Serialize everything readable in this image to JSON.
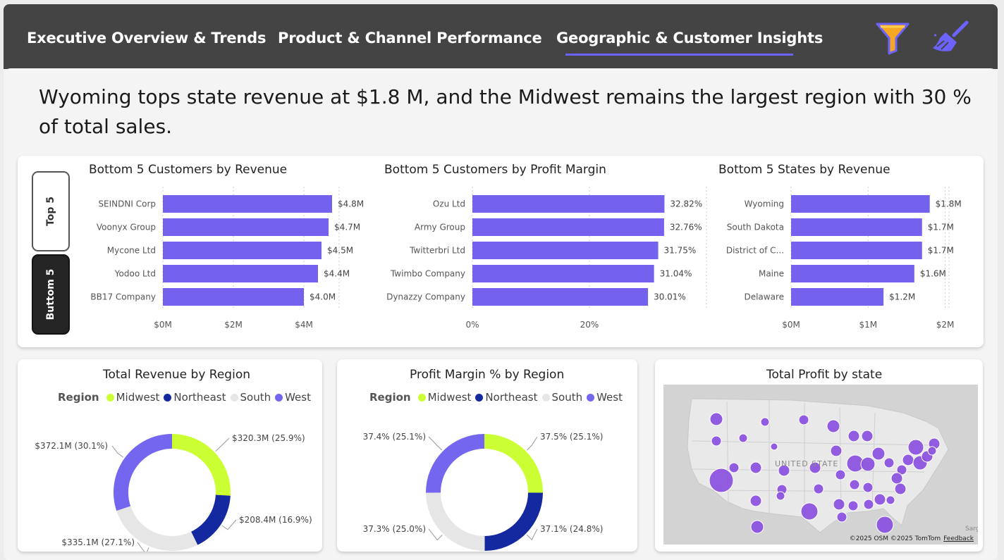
{
  "nav": {
    "tabs": [
      {
        "label": "Executive Overview & Trends"
      },
      {
        "label": "Product & Channel Performance"
      },
      {
        "label": "Geographic & Customer Insights"
      }
    ],
    "filter_icon": "filter-icon",
    "clear_icon": "broom-icon"
  },
  "headline": "Wyoming tops state revenue at $1.8 M, and the Midwest remains the largest region with 30 % of total sales.",
  "toggle": {
    "top_label": "Top 5",
    "bottom_label": "Buttom 5"
  },
  "colors": {
    "bar": "#7462ee",
    "midwest": "#ccff33",
    "northeast": "#1428a0",
    "south": "#e6e6e6",
    "west": "#7466ee",
    "bubble": "#8a4fe0"
  },
  "legend": {
    "title": "Region",
    "items": [
      "Midwest",
      "Northeast",
      "South",
      "West"
    ]
  },
  "map": {
    "title": "Total Profit by state",
    "label": "UNITED STATE",
    "edge_label": "Sarg",
    "attribution": "©2025 OSM  ©2025 TomTom",
    "feedback": "Feedback"
  },
  "chart_data": [
    {
      "type": "bar",
      "orientation": "horizontal",
      "title": "Bottom 5 Customers by Revenue",
      "categories": [
        "SEINDNI Corp",
        "Voonyx Group",
        "Mycone Ltd",
        "Yodoo Ltd",
        "BB17 Company"
      ],
      "values": [
        4.8,
        4.7,
        4.5,
        4.4,
        4.0
      ],
      "data_labels": [
        "$4.8M",
        "$4.7M",
        "$4.5M",
        "$4.4M",
        "$4.0M"
      ],
      "xlim": [
        0,
        5
      ],
      "ticks": [
        0,
        2,
        4
      ],
      "tick_labels": [
        "$0M",
        "$2M",
        "$4M"
      ]
    },
    {
      "type": "bar",
      "orientation": "horizontal",
      "title": "Bottom 5 Customers by Profit Margin",
      "categories": [
        "Ozu Ltd",
        "Army Group",
        "Twitterbri Ltd",
        "Twimbo Company",
        "Dynazzy Company"
      ],
      "values": [
        32.82,
        32.76,
        31.75,
        31.04,
        30.01
      ],
      "data_labels": [
        "32.82%",
        "32.76%",
        "31.75%",
        "31.04%",
        "30.01%"
      ],
      "xlim": [
        0,
        40
      ],
      "ticks": [
        0,
        20
      ],
      "tick_labels": [
        "0%",
        "20%"
      ]
    },
    {
      "type": "bar",
      "orientation": "horizontal",
      "title": "Bottom 5 States by Revenue",
      "categories": [
        "Wyoming",
        "South Dakota",
        "District of C...",
        "Maine",
        "Delaware"
      ],
      "values": [
        1.8,
        1.7,
        1.7,
        1.6,
        1.2
      ],
      "data_labels": [
        "$1.8M",
        "$1.7M",
        "$1.7M",
        "$1.6M",
        "$1.2M"
      ],
      "xlim": [
        0,
        2.05
      ],
      "ticks": [
        0,
        1,
        2
      ],
      "tick_labels": [
        "$0M",
        "$1M",
        "$2M"
      ]
    },
    {
      "type": "pie",
      "donut": true,
      "title": "Total Revenue by Region",
      "categories": [
        "Midwest",
        "Northeast",
        "South",
        "West"
      ],
      "values": [
        25.9,
        16.9,
        27.1,
        30.1
      ],
      "data_labels": [
        "$320.3M (25.9%)",
        "$208.4M (16.9%)",
        "$335.1M (27.1%)",
        "$372.1M (30.1%)"
      ]
    },
    {
      "type": "pie",
      "donut": true,
      "title": "Profit Margin % by Region",
      "categories": [
        "Midwest",
        "Northeast",
        "South",
        "West"
      ],
      "values": [
        25.1,
        24.8,
        25.0,
        25.1
      ],
      "data_labels": [
        "37.5% (25.1%)",
        "37.1% (24.8%)",
        "37.3% (25.0%)",
        "37.4% (25.1%)"
      ]
    }
  ]
}
